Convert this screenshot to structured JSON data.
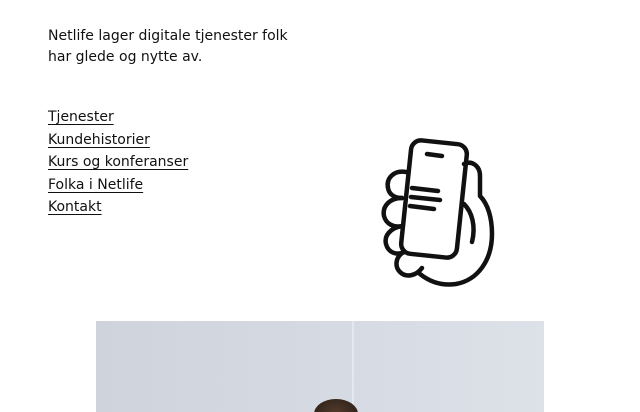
{
  "intro": {
    "line1": "Netlife lager digitale tjenester folk",
    "line2": "har glede og nytte av."
  },
  "nav": {
    "items": [
      {
        "label": "Tjenester"
      },
      {
        "label": "Kundehistorier"
      },
      {
        "label": "Kurs og konferanser"
      },
      {
        "label": "Folka i Netlife"
      },
      {
        "label": "Kontakt"
      }
    ]
  },
  "illustration": {
    "icon": "hand-holding-phone-icon"
  },
  "colors": {
    "text": "#111111",
    "background": "#ffffff",
    "photo_bg": "#d4d8e1"
  }
}
